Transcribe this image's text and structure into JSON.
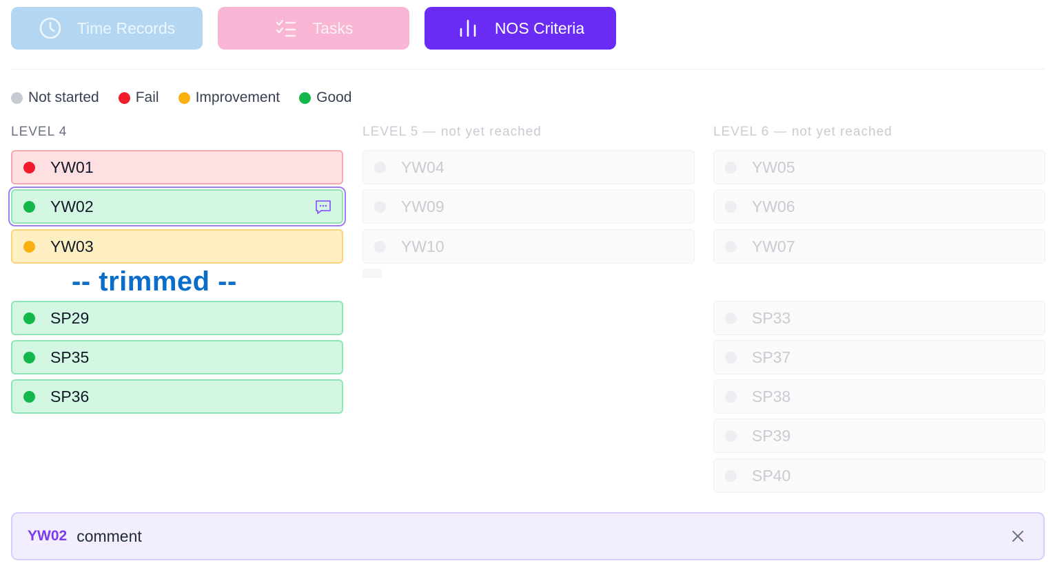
{
  "tabs": [
    {
      "label": "Time Records",
      "icon": "clock-icon"
    },
    {
      "label": "Tasks",
      "icon": "checklist-icon"
    },
    {
      "label": "NOS Criteria",
      "icon": "bar-chart-icon",
      "active": true
    }
  ],
  "legend": [
    {
      "label": "Not started",
      "color": "#c7cbd1"
    },
    {
      "label": "Fail",
      "color": "#f01c2e"
    },
    {
      "label": "Improvement",
      "color": "#f9b010"
    },
    {
      "label": "Good",
      "color": "#14b84a"
    }
  ],
  "levels": {
    "level4": {
      "title": "LEVEL 4",
      "items": [
        {
          "code": "YW01",
          "status": "fail"
        },
        {
          "code": "YW02",
          "status": "good",
          "selected": true,
          "has_comment": true
        },
        {
          "code": "YW03",
          "status": "improvement"
        },
        {
          "code": "SP29",
          "status": "good"
        },
        {
          "code": "SP35",
          "status": "good"
        },
        {
          "code": "SP36",
          "status": "good"
        }
      ]
    },
    "level5": {
      "title": "LEVEL 5 — not yet reached",
      "items": [
        {
          "code": "YW04",
          "status": "not_started"
        },
        {
          "code": "YW09",
          "status": "not_started"
        },
        {
          "code": "YW10",
          "status": "not_started"
        }
      ]
    },
    "level6": {
      "title": "LEVEL 6 — not yet reached",
      "items": [
        {
          "code": "YW05",
          "status": "not_started"
        },
        {
          "code": "YW06",
          "status": "not_started"
        },
        {
          "code": "YW07",
          "status": "not_started"
        },
        {
          "code": "SP33",
          "status": "not_started"
        },
        {
          "code": "SP37",
          "status": "not_started"
        },
        {
          "code": "SP38",
          "status": "not_started"
        },
        {
          "code": "SP39",
          "status": "not_started"
        },
        {
          "code": "SP40",
          "status": "not_started"
        }
      ]
    }
  },
  "trimmed_marker": "-- trimmed --",
  "comment_panel": {
    "code": "YW02",
    "label": "comment"
  },
  "colors": {
    "accent": "#6a2cf5",
    "fail": "#f01c2e",
    "improvement": "#f9b010",
    "good": "#14b84a",
    "not_started": "#c7cbd1"
  }
}
